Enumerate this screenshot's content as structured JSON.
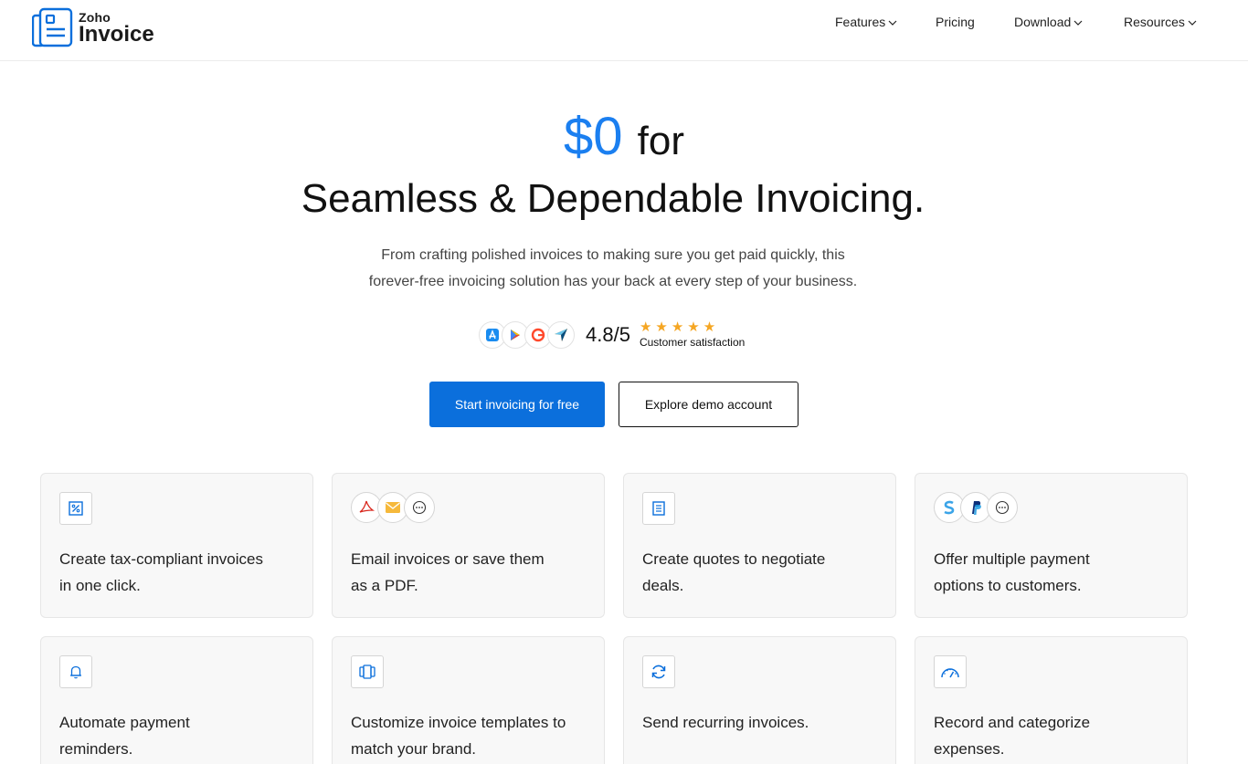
{
  "brand": {
    "zoho": "Zoho",
    "product": "Invoice",
    "color": "#0b6fdc"
  },
  "nav": {
    "items": [
      {
        "label": "Features",
        "dropdown": true
      },
      {
        "label": "Pricing",
        "dropdown": false
      },
      {
        "label": "Download",
        "dropdown": true
      },
      {
        "label": "Resources",
        "dropdown": true
      }
    ]
  },
  "hero": {
    "price": "$0",
    "for": "for",
    "headline": "Seamless & Dependable Invoicing.",
    "subtitle_line1": "From crafting polished invoices to making sure you get paid quickly, this",
    "subtitle_line2": "forever-free invoicing solution has your back at every step of your business."
  },
  "rating": {
    "badges": [
      "app-store-icon",
      "google-play-icon",
      "g2-icon",
      "capterra-icon"
    ],
    "score": "4.8/5",
    "stars": 5,
    "label": "Customer satisfaction",
    "star_color": "#f5a623"
  },
  "cta": {
    "primary": "Start invoicing for free",
    "secondary": "Explore demo account"
  },
  "features": [
    {
      "line1": "Create tax-compliant invoices",
      "line2": "in one click.",
      "icon": "percent-icon"
    },
    {
      "line1": "Email invoices or save them",
      "line2": "as a PDF.",
      "icons": [
        "pdf-icon",
        "mail-icon",
        "more-icon"
      ]
    },
    {
      "line1": "Create quotes to negotiate",
      "line2": "deals.",
      "icon": "document-icon"
    },
    {
      "line1": "Offer multiple payment",
      "line2": "options to customers.",
      "icons": [
        "stripe-icon",
        "paypal-icon",
        "more-icon"
      ]
    },
    {
      "line1": "Automate payment",
      "line2": "reminders.",
      "icon": "bell-icon"
    },
    {
      "line1": "Customize invoice templates to",
      "line2": "match your brand.",
      "icon": "templates-icon"
    },
    {
      "line1": "Send recurring invoices.",
      "line2": "",
      "icon": "recurring-icon"
    },
    {
      "line1": "Record and categorize",
      "line2": "expenses.",
      "icon": "gauge-icon"
    }
  ]
}
